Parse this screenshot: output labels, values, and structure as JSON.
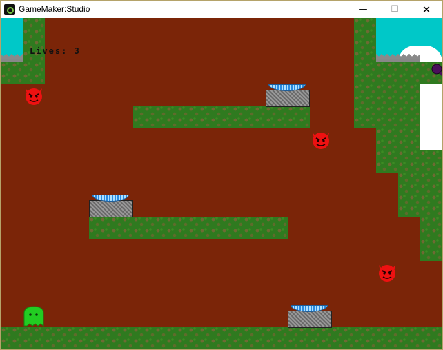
{
  "window": {
    "title": "GameMaker:Studio",
    "minimize_glyph": "—",
    "maximize_glyph": "☐",
    "close_glyph": "✕"
  },
  "hud": {
    "lives_text": "Lives: 3"
  },
  "icons": {
    "app": "gamemaker-icon",
    "player": "green-ghost-icon",
    "enemy": "red-devil-icon",
    "trampoline": "trampoline-icon",
    "spikes": "spikes-icon",
    "key": "purple-key-icon"
  },
  "colors": {
    "dirt": "#7b2508",
    "grass": "#2f7a1f",
    "sky": "#00c8c8",
    "enemy": "#ee1111",
    "player": "#22cc22",
    "trampoline_pad": "#2a8adf"
  }
}
